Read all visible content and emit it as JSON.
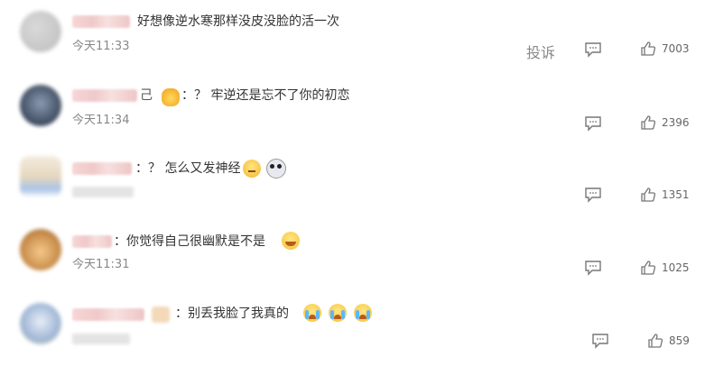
{
  "comments": [
    {
      "text": "好想像逆水寒那样没皮没脸的活一次",
      "time": "今天11:33",
      "likes": "7003",
      "complain": "投诉"
    },
    {
      "name_tail": "己",
      "text": "：？ 牢逆还是忘不了你的初恋",
      "time": "今天11:34",
      "likes": "2396"
    },
    {
      "text": "：？ 怎么又发神经",
      "likes": "1351"
    },
    {
      "text": "：你觉得自己很幽默是不是",
      "time": "今天11:31",
      "likes": "1025"
    },
    {
      "text": "：别丢我脸了我真的",
      "likes": "859"
    }
  ],
  "icons": {
    "reply": "comment-icon",
    "like": "thumbs-up-icon"
  },
  "colors": {
    "text": "#333333",
    "muted": "#888888"
  }
}
